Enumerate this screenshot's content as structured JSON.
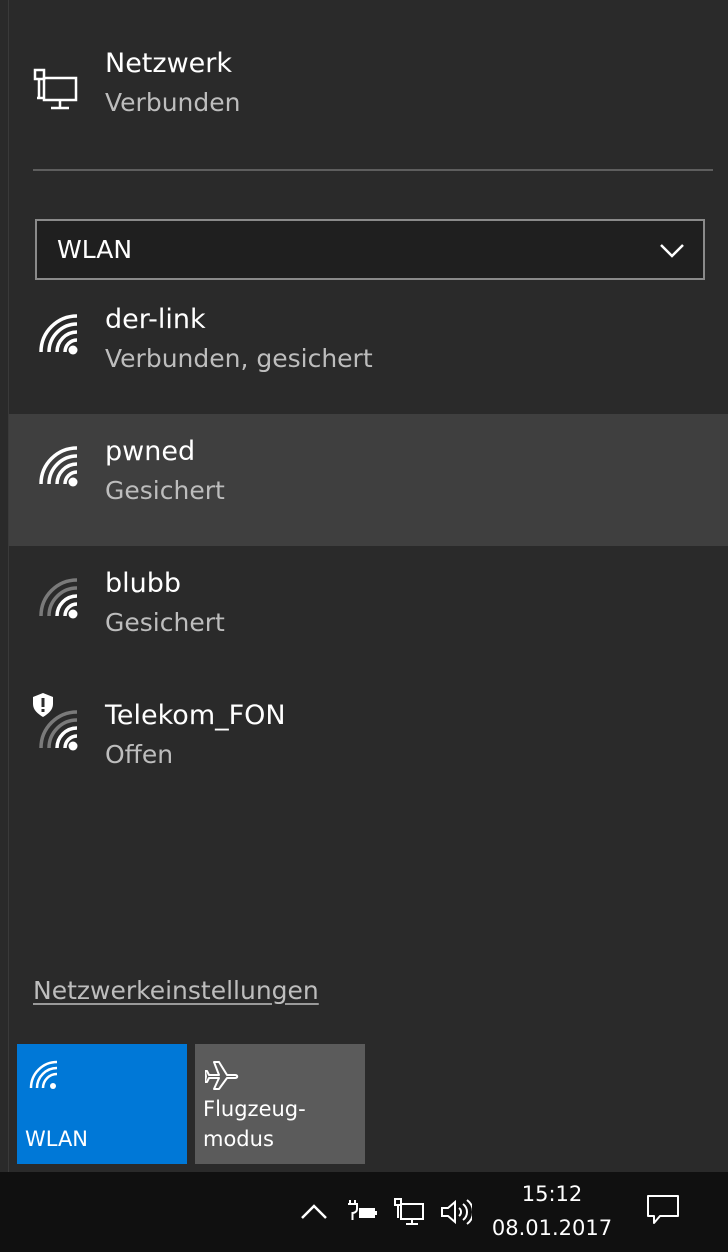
{
  "network": {
    "title": "Netzwerk",
    "status": "Verbunden",
    "icon": "network-computer-icon"
  },
  "dropdown": {
    "value": "WLAN",
    "icon": "chevron-down-icon"
  },
  "networks": [
    {
      "name": "der-link",
      "status": "Verbunden, gesichert",
      "icon": "wifi-icon"
    },
    {
      "name": "pwned",
      "status": "Gesichert",
      "icon": "wifi-icon"
    },
    {
      "name": "blubb",
      "status": "Gesichert",
      "icon": "wifi-weak-icon"
    },
    {
      "name": "Telekom_FON",
      "status": "Offen",
      "icon": "wifi-weak-icon",
      "warning_icon": "shield-warning-icon"
    }
  ],
  "settings_link": "Netzwerkeinstellungen",
  "quick_actions": {
    "wlan": {
      "label": "WLAN",
      "icon": "wifi-icon",
      "color": "#0078d7"
    },
    "airplane": {
      "label_line1": "Flugzeug-",
      "label_line2": "modus",
      "icon": "airplane-icon",
      "color": "#5b5b5b"
    }
  },
  "taskbar": {
    "time": "15:12",
    "date": "08.01.2017",
    "icons": [
      "chevron-up-icon",
      "power-battery-icon",
      "network-computer-icon",
      "volume-icon",
      "action-center-icon"
    ]
  },
  "colors": {
    "accent": "#0078d7",
    "flyout_bg": "#2b2b2b",
    "hover_bg": "#3f3f3f",
    "secondary_text": "#bdbdbd"
  }
}
